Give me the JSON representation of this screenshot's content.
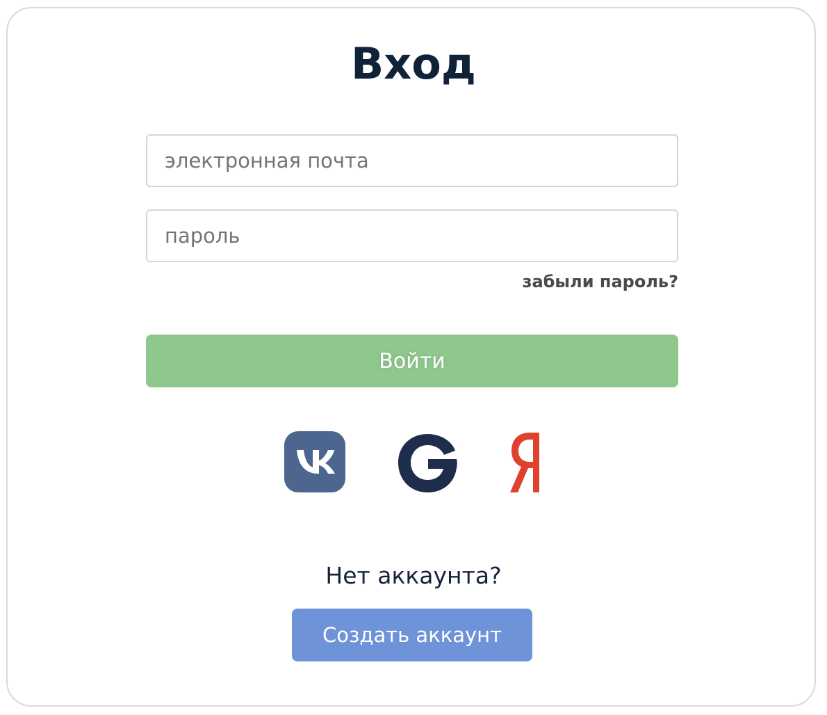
{
  "login": {
    "title": "Вход",
    "email_placeholder": "электронная почта",
    "email_value": "",
    "password_placeholder": "пароль",
    "password_value": "",
    "forgot_password": "забыли пароль?",
    "submit_label": "Войти",
    "submit_color": "#8fc88c"
  },
  "social": {
    "icons": [
      "vk-icon",
      "google-icon",
      "yandex-icon"
    ],
    "vk_color": "#4c6690",
    "google_color": "#1f2d4d",
    "yandex_color": "#e0412f"
  },
  "signup": {
    "prompt": "Нет аккаунта?",
    "button_label": "Создать аккаунт",
    "button_color": "#6f93d8"
  }
}
